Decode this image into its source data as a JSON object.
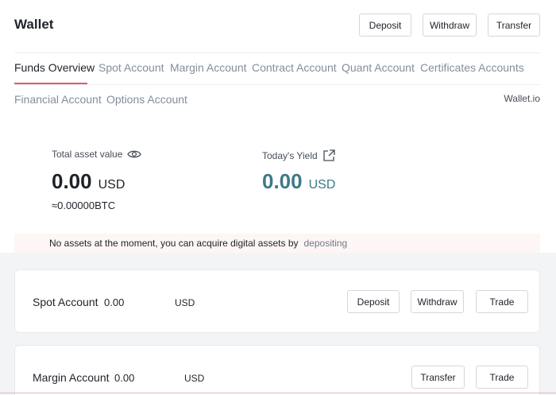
{
  "header": {
    "title": "Wallet",
    "buttons": {
      "deposit": "Deposit",
      "withdraw": "Withdraw",
      "transfer": "Transfer"
    }
  },
  "tabs": [
    {
      "label": "Funds Overview",
      "active": true
    },
    {
      "label": "Spot Account"
    },
    {
      "label": "Margin Account"
    },
    {
      "label": "Contract Account"
    },
    {
      "label": "Quant Account"
    },
    {
      "label": "Certificates Accounts"
    },
    {
      "label": "Financial Account"
    },
    {
      "label": "Options Account"
    }
  ],
  "site_link": "Wallet.io",
  "overview": {
    "total_label": "Total asset value",
    "total_value": "0.00",
    "total_unit": "USD",
    "btc_value": "≈0.00000BTC",
    "yield_label": "Today's Yield",
    "yield_value": "0.00",
    "yield_unit": "USD"
  },
  "notice": {
    "text": "No assets at the moment, you can acquire digital assets by",
    "link": "depositing"
  },
  "accounts": [
    {
      "name": "Spot Account",
      "amount": "0.00",
      "unit": "USD",
      "buttons": [
        "Deposit",
        "Withdraw",
        "Trade"
      ]
    },
    {
      "name": "Margin Account",
      "amount": "0.00",
      "unit": "USD",
      "buttons": [
        "Transfer",
        "Trade"
      ]
    }
  ],
  "colors": {
    "accent_underline": "#e15a67",
    "yield_teal": "#3d7a85",
    "notice_bg": "#fdf6f4"
  },
  "icons": {
    "visibility": "eye-icon",
    "share": "share-icon"
  }
}
